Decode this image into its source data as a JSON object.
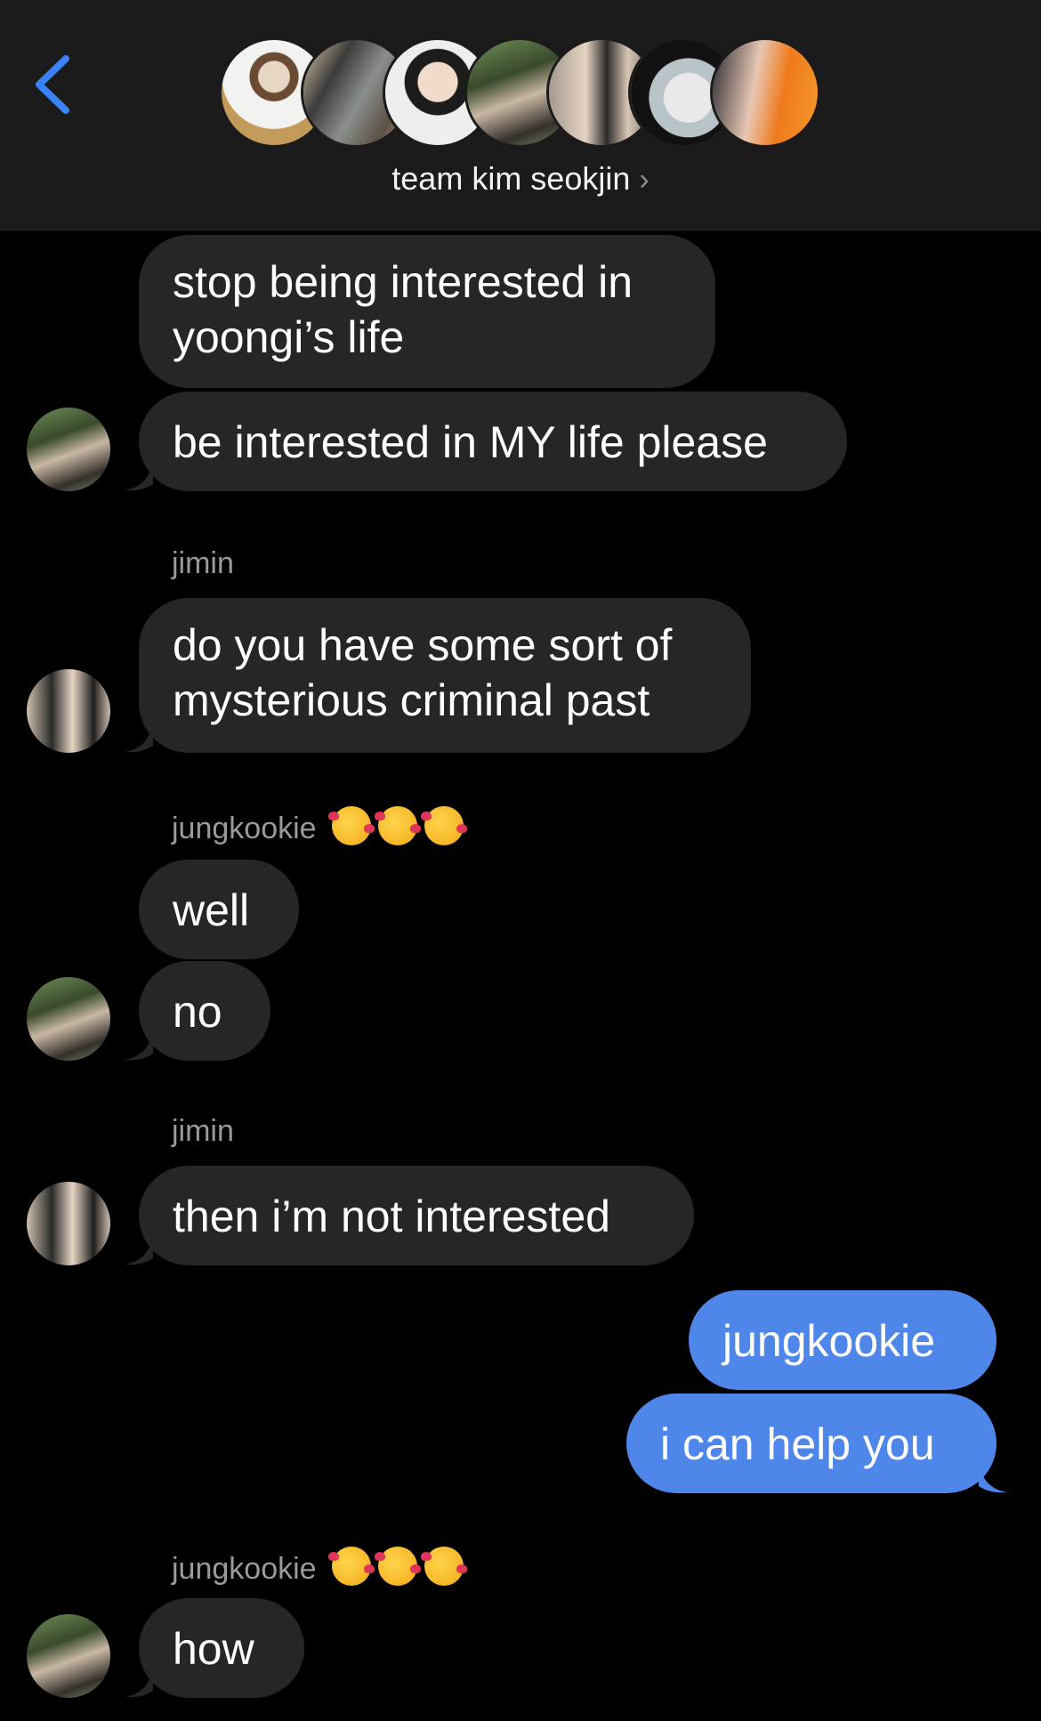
{
  "header": {
    "back_icon": "chevron-left-icon",
    "group_name": "team kim seokjin",
    "chevron": "›",
    "accent_color": "#3a82f7",
    "avatar_count": 7
  },
  "messages": [
    {
      "sender": "",
      "text": [
        "stop being interested in",
        "yoongi’s life"
      ],
      "direction": "incoming"
    },
    {
      "sender": "",
      "text": [
        "be interested in MY life please"
      ],
      "direction": "incoming"
    },
    {
      "sender": "jimin",
      "text": [
        "do you have some sort of",
        "mysterious criminal past"
      ],
      "direction": "incoming"
    },
    {
      "sender": "jungkookie",
      "sender_emoji": "smiling-face-with-hearts ×3",
      "text": [
        "well"
      ],
      "direction": "incoming"
    },
    {
      "sender": "",
      "text": [
        "no"
      ],
      "direction": "incoming"
    },
    {
      "sender": "jimin",
      "text": [
        "then i’m not interested"
      ],
      "direction": "incoming"
    },
    {
      "sender": "",
      "text": [
        "jungkookie"
      ],
      "direction": "outgoing"
    },
    {
      "sender": "",
      "text": [
        "i can help you"
      ],
      "direction": "outgoing"
    },
    {
      "sender": "jungkookie",
      "sender_emoji": "smiling-face-with-hearts ×3",
      "text": [
        "how"
      ],
      "direction": "incoming"
    }
  ],
  "colors": {
    "incoming_bubble": "#262628",
    "outgoing_bubble": "#4f86ea",
    "sender_label": "#9a9a9e",
    "background": "#000000"
  }
}
